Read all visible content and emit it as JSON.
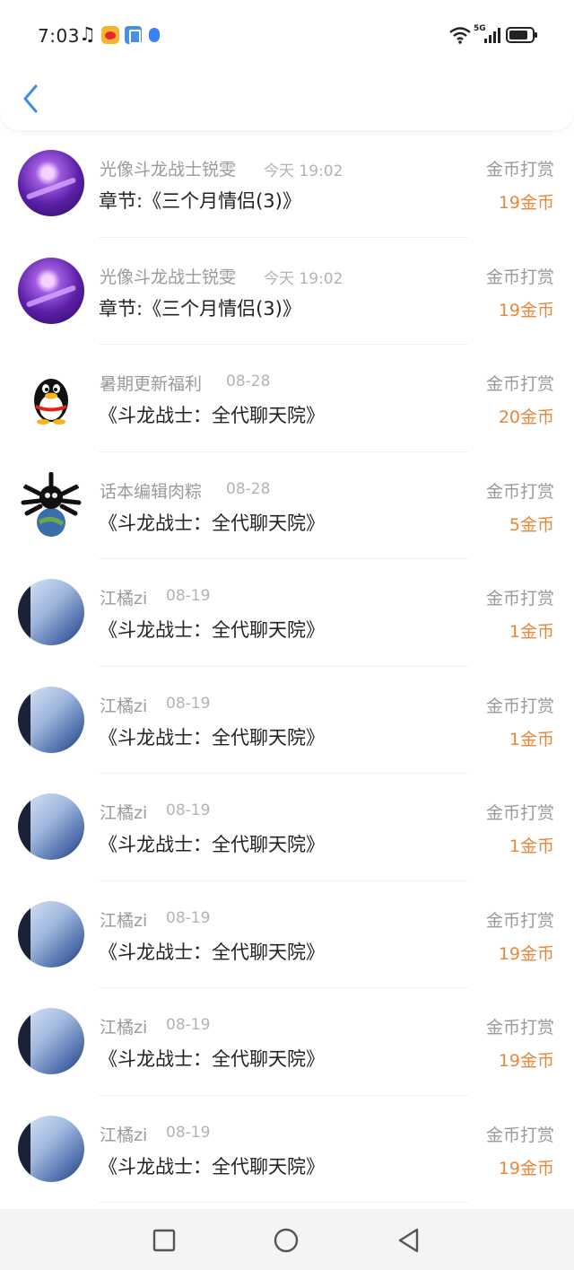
{
  "status_bar": {
    "time": "7:03",
    "icons": [
      "music-icon",
      "weibo-icon",
      "app-icon",
      "badge-icon",
      "wifi-icon",
      "signal-icon",
      "battery-icon"
    ],
    "network": "5G"
  },
  "header": {
    "back_icon": "chevron-left-icon"
  },
  "colors": {
    "accent": "#3a8ee6",
    "amount": "#e8873a",
    "muted": "#9a9a9a",
    "title": "#222222"
  },
  "items": [
    {
      "avatar": "purple",
      "name": "光像斗龙战士锐雯",
      "date": "今天 19:02",
      "title": "章节:《三个月情侣(3)》",
      "type": "金币打赏",
      "amount": "19金币"
    },
    {
      "avatar": "purple",
      "name": "光像斗龙战士锐雯",
      "date": "今天 19:02",
      "title": "章节:《三个月情侣(3)》",
      "type": "金币打赏",
      "amount": "19金币"
    },
    {
      "avatar": "qq",
      "name": "暑期更新福利",
      "date": "08-28",
      "title": "《斗龙战士：全代聊天院》",
      "type": "金币打赏",
      "amount": "20金币"
    },
    {
      "avatar": "dark",
      "name": "话本编辑肉粽",
      "date": "08-28",
      "title": "《斗龙战士：全代聊天院》",
      "type": "金币打赏",
      "amount": "5金币"
    },
    {
      "avatar": "blue",
      "name": "江橘zi",
      "date": "08-19",
      "title": "《斗龙战士：全代聊天院》",
      "type": "金币打赏",
      "amount": "1金币"
    },
    {
      "avatar": "blue",
      "name": "江橘zi",
      "date": "08-19",
      "title": "《斗龙战士：全代聊天院》",
      "type": "金币打赏",
      "amount": "1金币"
    },
    {
      "avatar": "blue",
      "name": "江橘zi",
      "date": "08-19",
      "title": "《斗龙战士：全代聊天院》",
      "type": "金币打赏",
      "amount": "1金币"
    },
    {
      "avatar": "blue",
      "name": "江橘zi",
      "date": "08-19",
      "title": "《斗龙战士：全代聊天院》",
      "type": "金币打赏",
      "amount": "19金币"
    },
    {
      "avatar": "blue",
      "name": "江橘zi",
      "date": "08-19",
      "title": "《斗龙战士：全代聊天院》",
      "type": "金币打赏",
      "amount": "19金币"
    },
    {
      "avatar": "blue",
      "name": "江橘zi",
      "date": "08-19",
      "title": "《斗龙战士：全代聊天院》",
      "type": "金币打赏",
      "amount": "19金币"
    }
  ],
  "nav_bar": {
    "buttons": [
      "recents-square-icon",
      "home-circle-icon",
      "back-triangle-icon"
    ]
  }
}
